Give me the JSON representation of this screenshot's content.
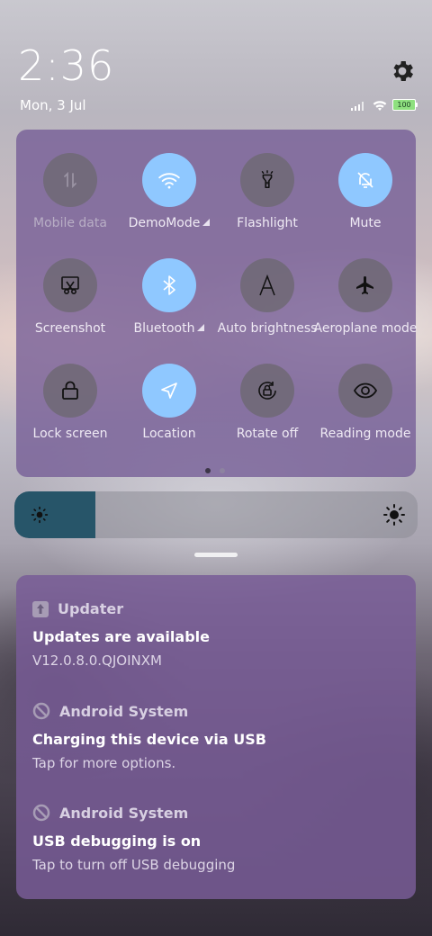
{
  "status": {
    "time": "2:36",
    "date": "Mon, 3 Jul",
    "battery": "100"
  },
  "quick_settings": {
    "tiles": [
      {
        "id": "mobile-data",
        "label": "Mobile data",
        "active": false,
        "disabled": true,
        "icon": "mobile-data-icon",
        "has_arrow": false
      },
      {
        "id": "wifi",
        "label": "DemoMode",
        "active": true,
        "disabled": false,
        "icon": "wifi-icon",
        "has_arrow": true
      },
      {
        "id": "flashlight",
        "label": "Flashlight",
        "active": false,
        "disabled": false,
        "icon": "flashlight-icon",
        "has_arrow": false
      },
      {
        "id": "mute",
        "label": "Mute",
        "active": true,
        "disabled": false,
        "icon": "bell-off-icon",
        "has_arrow": false
      },
      {
        "id": "screenshot",
        "label": "Screenshot",
        "active": false,
        "disabled": false,
        "icon": "scissors-icon",
        "has_arrow": false
      },
      {
        "id": "bluetooth",
        "label": "Bluetooth",
        "active": true,
        "disabled": false,
        "icon": "bluetooth-icon",
        "has_arrow": true
      },
      {
        "id": "auto-brightness",
        "label": "Auto brightness",
        "active": false,
        "disabled": false,
        "icon": "auto-brightness-icon",
        "has_arrow": false
      },
      {
        "id": "aeroplane",
        "label": "Aeroplane mode",
        "active": false,
        "disabled": false,
        "icon": "airplane-icon",
        "has_arrow": false
      },
      {
        "id": "lock-screen",
        "label": "Lock screen",
        "active": false,
        "disabled": false,
        "icon": "lock-icon",
        "has_arrow": false
      },
      {
        "id": "location",
        "label": "Location",
        "active": true,
        "disabled": false,
        "icon": "location-icon",
        "has_arrow": false
      },
      {
        "id": "rotate",
        "label": "Rotate off",
        "active": false,
        "disabled": false,
        "icon": "rotate-lock-icon",
        "has_arrow": false
      },
      {
        "id": "reading",
        "label": "Reading mode",
        "active": false,
        "disabled": false,
        "icon": "eye-icon",
        "has_arrow": false
      }
    ],
    "page_current": 1,
    "page_count": 2
  },
  "brightness": {
    "level": 0.2
  },
  "notifications": [
    {
      "app": "Updater",
      "title": "Updates are available",
      "text": "V12.0.8.0.QJOINXM",
      "icon": "updater-icon"
    },
    {
      "app": "Android System",
      "title": "Charging this device via USB",
      "text": "Tap for more options.",
      "icon": "android-system-icon"
    },
    {
      "app": "Android System",
      "title": "USB debugging is on",
      "text": "Tap to turn off USB debugging",
      "icon": "android-system-icon"
    }
  ],
  "colors": {
    "active_tile": "#8fc8ff",
    "inactive_tile": "#6e6874",
    "panel": "#745c96",
    "brightness_fill": "#275569"
  }
}
